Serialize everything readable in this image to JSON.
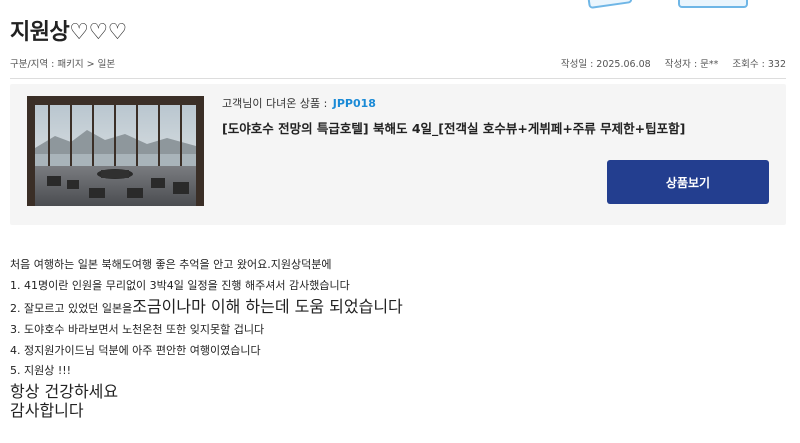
{
  "page": {
    "title": "지원상♡♡♡"
  },
  "breadcrumb": "구분/지역 : 패키지 > 일본",
  "meta": {
    "date": "작성일 : 2025.06.08",
    "author": "작성자 : 문**",
    "views": "조회수 : 332"
  },
  "product": {
    "code_label": "고객님이 다녀온 상품 :",
    "code": "JPP018",
    "name": "[도야호수 전망의 특급호텔] 북해도 4일_[전객실 호수뷰+게뷔페+주류 무제한+팁포함]",
    "button_label": "상품보기",
    "image_icon": "hotel-lobby-lake-view-photo"
  },
  "review": {
    "line1": "처음 여행하는 일본 북해도여행 좋은 추억을 안고 왔어요.지원상덕분에",
    "line2": "1.  41명이란 인원을 무리없이 3박4일 일정을 진행 해주셔서  감사했습니다",
    "line3_pre": "2. 잘모르고 있었던 일본을",
    "line3_big": "조금이나마 이해 하는데 도움 되었습니다",
    "line4": "3. 도야호수 바라보면서 노천온천  또한 잊지못할 겁니다",
    "line5": "4. 정지원가이드님 덕분에 아주 편안한 여행이였습니다",
    "line6": "5. 지원상 !!!",
    "line7": "항상 건강하세요",
    "line8": "감사합니다"
  },
  "colors": {
    "accent_button": "#233e8f",
    "product_code": "#1a8ad6",
    "box_bg": "#f5f5f5"
  }
}
